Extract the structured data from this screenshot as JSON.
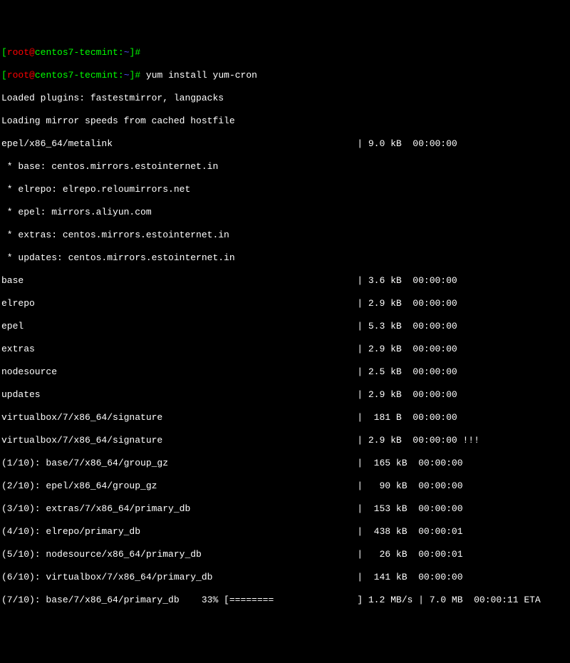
{
  "prompt": {
    "open": "[",
    "user": "root",
    "at": "@",
    "host": "centos7-tecmint",
    "colon": ":",
    "path": "~",
    "close": "]",
    "hash": "#"
  },
  "commands": {
    "line1_cmd": "",
    "line2_cmd": " yum install yum-cron"
  },
  "output": {
    "plugins": "Loaded plugins: fastestmirror, langpacks",
    "loading": "Loading mirror speeds from cached hostfile",
    "metalink": "epel/x86_64/metalink                                            | 9.0 kB  00:00:00",
    "mirror1": " * base: centos.mirrors.estointernet.in",
    "mirror2": " * elrepo: elrepo.reloumirrors.net",
    "mirror3": " * epel: mirrors.aliyun.com",
    "mirror4": " * extras: centos.mirrors.estointernet.in",
    "mirror5": " * updates: centos.mirrors.estointernet.in",
    "repo1": "base                                                            | 3.6 kB  00:00:00",
    "repo2": "elrepo                                                          | 2.9 kB  00:00:00",
    "repo3": "epel                                                            | 5.3 kB  00:00:00",
    "repo4": "extras                                                          | 2.9 kB  00:00:00",
    "repo5": "nodesource                                                      | 2.5 kB  00:00:00",
    "repo6": "updates                                                         | 2.9 kB  00:00:00",
    "repo7": "virtualbox/7/x86_64/signature                                   |  181 B  00:00:00",
    "repo8": "virtualbox/7/x86_64/signature                                   | 2.9 kB  00:00:00 !!!",
    "dl1": "(1/10): base/7/x86_64/group_gz                                  |  165 kB  00:00:00",
    "dl2": "(2/10): epel/x86_64/group_gz                                    |   90 kB  00:00:00",
    "dl3": "(3/10): extras/7/x86_64/primary_db                              |  153 kB  00:00:00",
    "dl4": "(4/10): elrepo/primary_db                                       |  438 kB  00:00:01",
    "dl5": "(5/10): nodesource/x86_64/primary_db                            |   26 kB  00:00:01",
    "dl6": "(6/10): virtualbox/7/x86_64/primary_db                          |  141 kB  00:00:00",
    "dl7": "(7/10): base/7/x86_64/primary_db    33% [========               ] 1.2 MB/s | 7.0 MB  00:00:11 ETA"
  }
}
